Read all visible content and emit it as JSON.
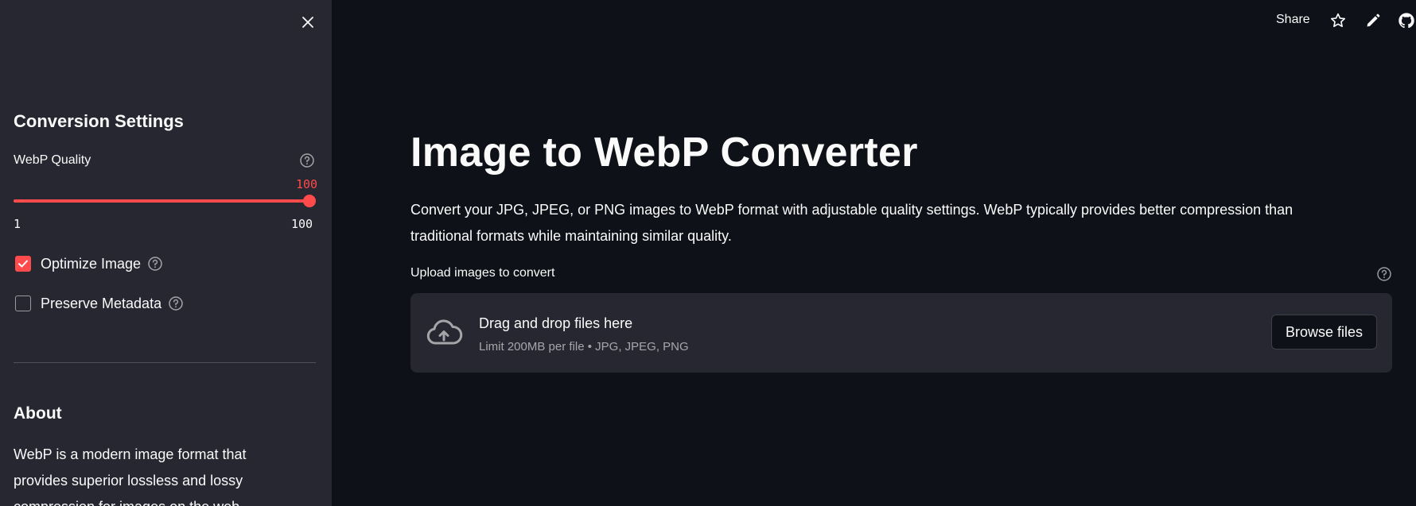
{
  "sidebar": {
    "close_icon": "close-icon",
    "settings_title": "Conversion Settings",
    "quality": {
      "label": "WebP Quality",
      "value": "100",
      "min": "1",
      "max": "100",
      "fraction": 1.0
    },
    "optimize": {
      "label": "Optimize Image",
      "checked": true
    },
    "preserve": {
      "label": "Preserve Metadata",
      "checked": false
    },
    "about_title": "About",
    "about_text": "WebP is a modern image format that provides superior lossless and lossy compression for images on the web."
  },
  "topbar": {
    "share_label": "Share",
    "icons": [
      "star-icon",
      "pencil-icon",
      "github-icon"
    ]
  },
  "main": {
    "title": "Image to WebP Converter",
    "description": "Convert your JPG, JPEG, or PNG images to WebP format with adjustable quality settings. WebP typically provides better compression than traditional formats while maintaining similar quality.",
    "uploader": {
      "label": "Upload images to convert",
      "dropzone_title": "Drag and drop files here",
      "dropzone_subtitle": "Limit 200MB per file • JPG, JPEG, PNG",
      "browse_label": "Browse files"
    }
  },
  "colors": {
    "accent": "#ff4b4b",
    "background": "#0e1117",
    "sidebar_bg": "#262730",
    "text": "#fafafa"
  }
}
